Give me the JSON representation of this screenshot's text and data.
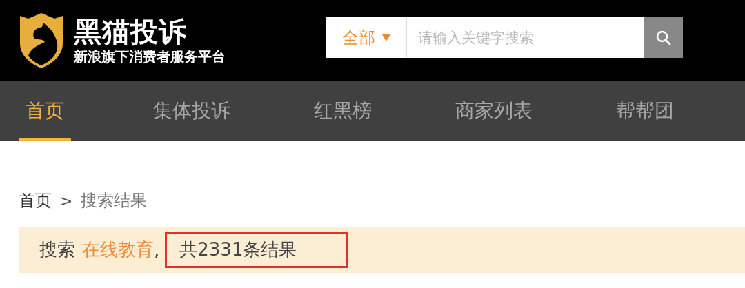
{
  "header": {
    "logo_title": "黑猫投诉",
    "logo_subtitle": "新浪旗下消费者服务平台",
    "search": {
      "scope": "全部",
      "placeholder": "请输入关键字搜索"
    }
  },
  "nav": [
    {
      "label": "首页",
      "selected": true
    },
    {
      "label": "集体投诉",
      "selected": false
    },
    {
      "label": "红黑榜",
      "selected": false
    },
    {
      "label": "商家列表",
      "selected": false
    },
    {
      "label": "帮帮团",
      "selected": false
    }
  ],
  "breadcrumb": [
    {
      "label": "首页",
      "current": false
    },
    {
      "label": "搜索结果",
      "current": true
    }
  ],
  "breadcrumb_separator": ">",
  "result": {
    "prefix": "搜索",
    "keyword": "在线教育",
    "separator": ",",
    "count_text": "共2331条结果",
    "highlighted": true
  }
}
